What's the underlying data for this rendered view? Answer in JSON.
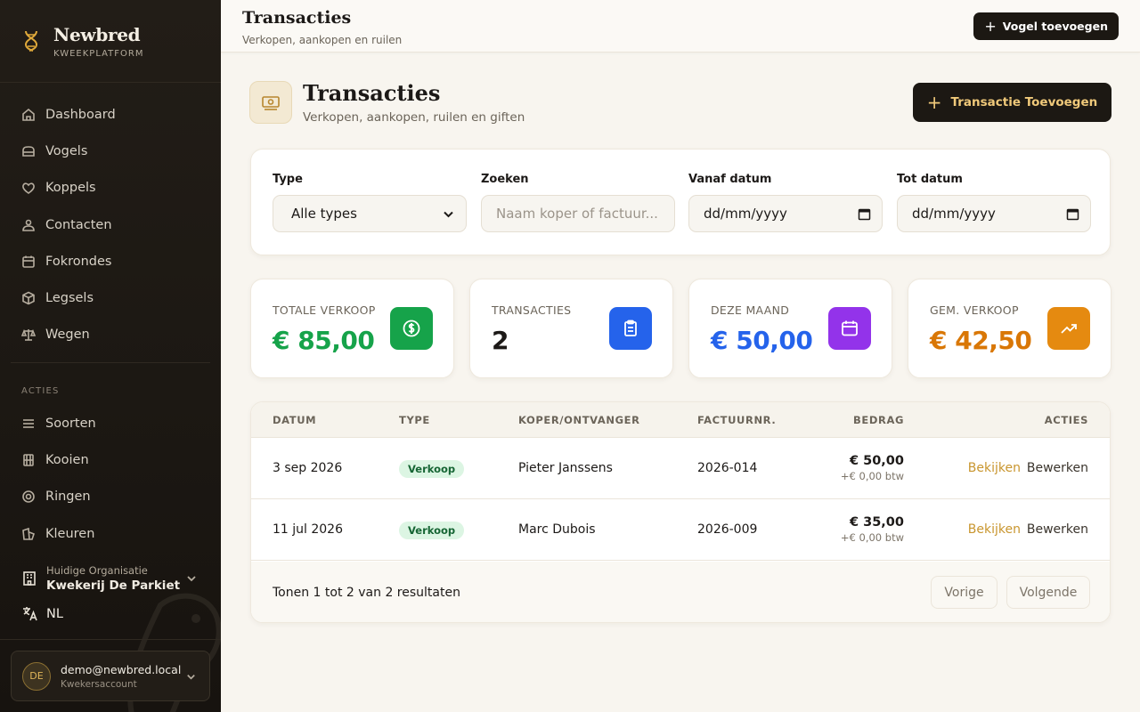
{
  "brand": {
    "name": "Newbred",
    "subtitle": "KWEEKPLATFORM"
  },
  "sidebar": {
    "items": [
      {
        "label": "Dashboard",
        "icon": "home-icon"
      },
      {
        "label": "Vogels",
        "icon": "bird-icon"
      },
      {
        "label": "Koppels",
        "icon": "heart-icon"
      },
      {
        "label": "Contacten",
        "icon": "users-icon"
      },
      {
        "label": "Fokrondes",
        "icon": "calendar-icon"
      },
      {
        "label": "Legsels",
        "icon": "egg-box-icon"
      },
      {
        "label": "Wegen",
        "icon": "scale-icon"
      }
    ],
    "section_label": "ACTIES",
    "actions": [
      {
        "label": "Soorten",
        "icon": "list-icon"
      },
      {
        "label": "Kooien",
        "icon": "cage-icon"
      },
      {
        "label": "Ringen",
        "icon": "ring-icon"
      },
      {
        "label": "Kleuren",
        "icon": "palette-icon"
      }
    ],
    "org": {
      "caption": "Huidige Organisatie",
      "name": "Kwekerij De Parkiet"
    },
    "language": "NL",
    "account": {
      "initials": "DE",
      "email": "demo@newbred.local",
      "type": "Kwekersaccount"
    }
  },
  "topbar": {
    "title": "Transacties",
    "subtitle": "Verkopen, aankopen en ruilen",
    "button": "Vogel toevoegen"
  },
  "page": {
    "title": "Transacties",
    "subtitle": "Verkopen, aankopen, ruilen en giften",
    "add_button": "Transactie Toevoegen"
  },
  "filters": {
    "type": {
      "label": "Type",
      "value": "Alle types"
    },
    "search": {
      "label": "Zoeken",
      "placeholder": "Naam koper of factuur..."
    },
    "from": {
      "label": "Vanaf datum",
      "value": "dd/mm/yyyy"
    },
    "to": {
      "label": "Tot datum",
      "value": "dd/mm/yyyy"
    }
  },
  "stats": [
    {
      "label": "TOTALE VERKOOP",
      "value": "€ 85,00",
      "color": "#16a34a",
      "icon": "dollar-icon",
      "icon_bg": "#16a34a"
    },
    {
      "label": "TRANSACTIES",
      "value": "2",
      "color": "#1c1917",
      "icon": "clipboard-icon",
      "icon_bg": "#2563eb"
    },
    {
      "label": "DEZE MAAND",
      "value": "€ 50,00",
      "color": "#2563eb",
      "icon": "calendar-icon",
      "icon_bg": "#9333ea"
    },
    {
      "label": "GEM. VERKOOP",
      "value": "€ 42,50",
      "color": "#d97706",
      "icon": "trending-up-icon",
      "icon_bg": "#e58a10"
    }
  ],
  "table": {
    "headers": [
      "DATUM",
      "TYPE",
      "KOPER/ONTVANGER",
      "FACTUURNR.",
      "BEDRAG",
      "ACTIES"
    ],
    "rows": [
      {
        "date": "3 sep 2026",
        "type": "Verkoop",
        "party": "Pieter Janssens",
        "invoice": "2026-014",
        "amount": "€ 50,00",
        "vat": "+€ 0,00 btw",
        "view": "Bekijken",
        "edit": "Bewerken"
      },
      {
        "date": "11 jul 2026",
        "type": "Verkoop",
        "party": "Marc Dubois",
        "invoice": "2026-009",
        "amount": "€ 35,00",
        "vat": "+€ 0,00 btw",
        "view": "Bekijken",
        "edit": "Bewerken"
      }
    ],
    "footer": "Tonen 1 tot 2 van 2 resultaten",
    "prev": "Vorige",
    "next": "Volgende"
  }
}
